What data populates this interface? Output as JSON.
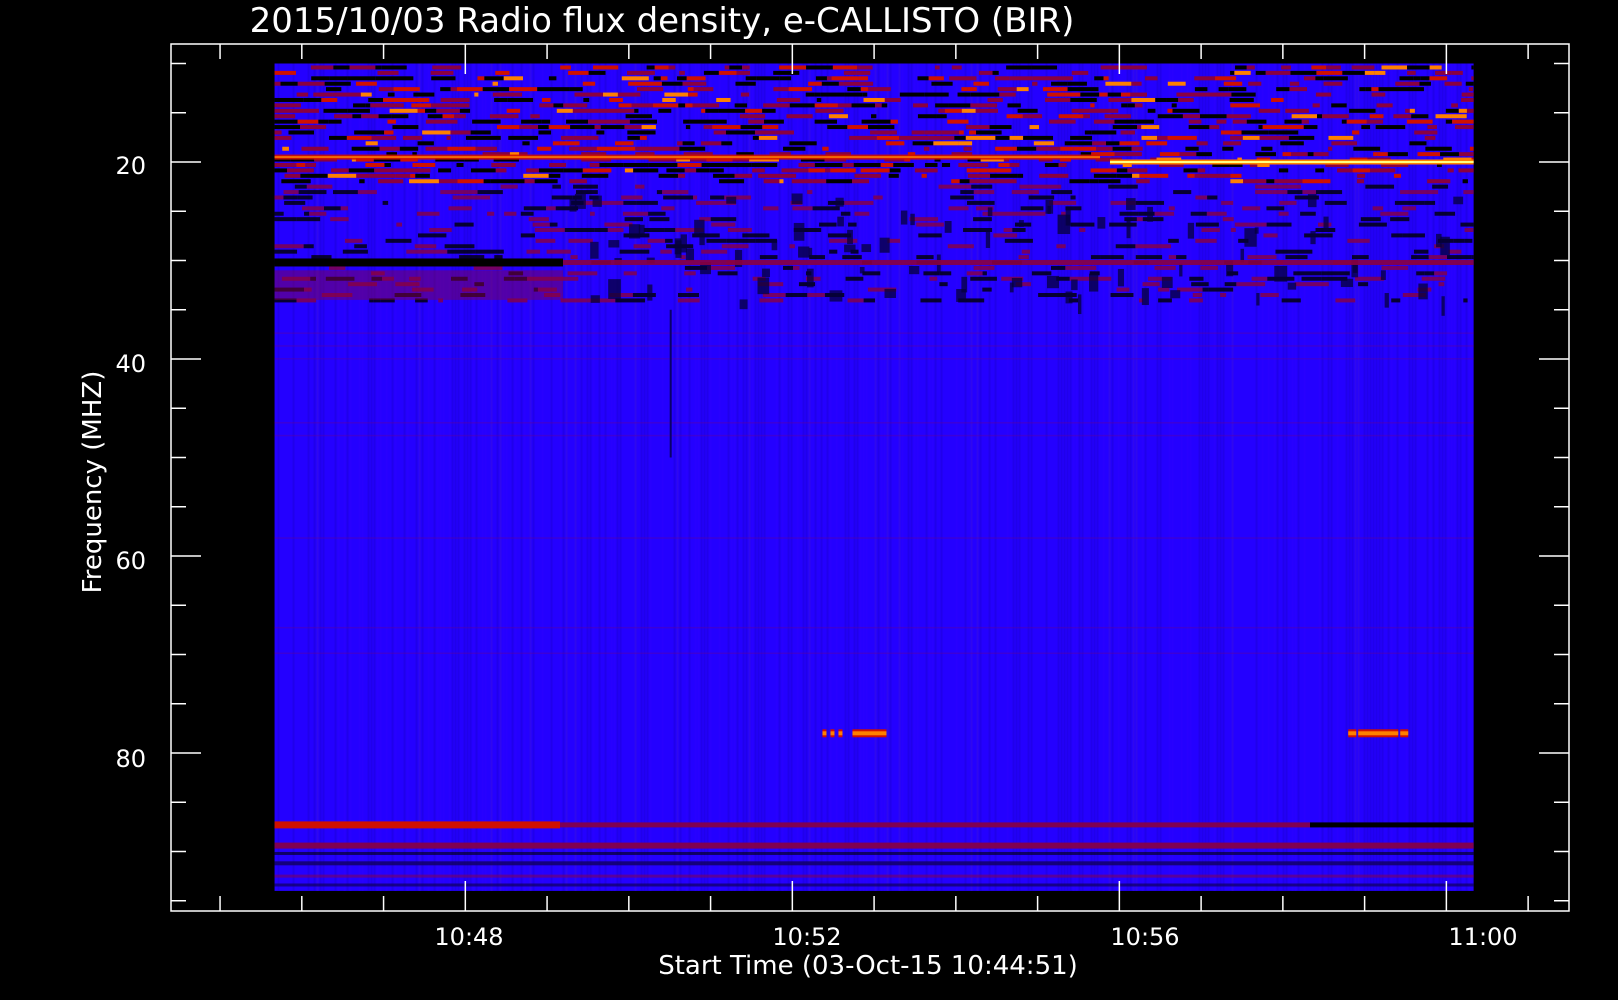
{
  "chart_data": {
    "type": "heatmap",
    "title": "2015/10/03  Radio flux density, e-CALLISTO (BIR)",
    "xlabel": "Start Time (03-Oct-15 10:44:51)",
    "ylabel": "Frequency (MHZ)",
    "x_ticks": [
      "10:48",
      "10:52",
      "10:56",
      "11:00"
    ],
    "y_ticks": [
      "20",
      "40",
      "60",
      "80"
    ],
    "x_range_minutes": [
      10.74,
      11.03
    ],
    "y_range_mhz": [
      95,
      10
    ],
    "data_x_range": [
      "10:45:40",
      "11:00:20"
    ],
    "data_y_range_mhz": [
      94,
      10
    ],
    "colormap": [
      "#000000",
      "#1a00c8",
      "#2400ff",
      "#8a0040",
      "#d01000",
      "#ff8000",
      "#ffff80"
    ],
    "features": [
      {
        "kind": "band",
        "freq_mhz": [
          10,
          20
        ],
        "level": "high",
        "note": "interference lines"
      },
      {
        "kind": "band",
        "freq_mhz": 19.5,
        "level": "very-high"
      },
      {
        "kind": "band",
        "freq_mhz": 30,
        "level": "medium"
      },
      {
        "kind": "band",
        "freq_mhz": 87.5,
        "level": "medium"
      },
      {
        "kind": "band",
        "freq_mhz": 89.5,
        "level": "medium"
      },
      {
        "kind": "burst",
        "freq_mhz": 78,
        "time": "10:52:50",
        "level": "high"
      },
      {
        "kind": "burst",
        "freq_mhz": 78,
        "time": "10:59:10",
        "level": "high"
      }
    ]
  }
}
